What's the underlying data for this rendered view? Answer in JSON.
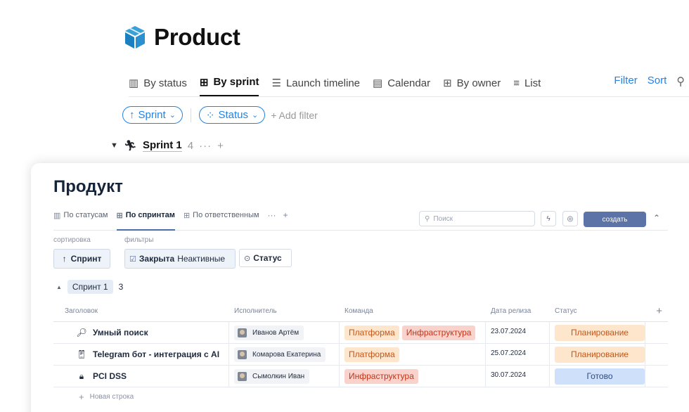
{
  "page": {
    "title": "Product",
    "icon": "cube-icon",
    "tabs": [
      {
        "label": "By status",
        "icon": "columns-icon"
      },
      {
        "label": "By sprint",
        "icon": "table-icon",
        "active": true
      },
      {
        "label": "Launch timeline",
        "icon": "timeline-icon"
      },
      {
        "label": "Calendar",
        "icon": "calendar-icon"
      },
      {
        "label": "By owner",
        "icon": "grid-icon"
      },
      {
        "label": "List",
        "icon": "list-icon"
      }
    ],
    "actions": {
      "filter": "Filter",
      "sort": "Sort"
    },
    "filters": {
      "sprint": "Sprint",
      "status": "Status",
      "add_filter": "Add filter"
    },
    "group": {
      "name": "Sprint 1",
      "count": "4"
    }
  },
  "card": {
    "title": "Продукт",
    "tabs": [
      {
        "label": "По статусам",
        "icon": "columns-icon"
      },
      {
        "label": "По спринтам",
        "icon": "table-icon",
        "active": true
      },
      {
        "label": "По ответственным",
        "icon": "table-icon"
      }
    ],
    "more": "···",
    "plus": "+",
    "search_placeholder": "Поиск",
    "create_label": "создать",
    "sort_caption": "сортировка",
    "filter_caption": "фильтры",
    "sort_value": "Спринт",
    "filter_closed": "Закрыта",
    "filter_inactive": "Неактивные",
    "status_filter": "Статус",
    "group": {
      "name": "Спринт 1",
      "count": "3"
    },
    "columns": [
      "Заголовок",
      "Исполнитель",
      "Команда",
      "Дата релиза",
      "Статус"
    ],
    "rows": [
      {
        "icon": "magnifier-icon",
        "title": "Умный поиск",
        "assignee": "Иванов Артём",
        "teams": [
          {
            "name": "Платформа",
            "color": "orange"
          },
          {
            "name": "Инфраструктура",
            "color": "red"
          }
        ],
        "date": "23.07.2024",
        "status": "Планирование",
        "status_kind": "plan"
      },
      {
        "icon": "phone-icon",
        "title": "Telegram бот - интеграция с AI",
        "assignee": "Комарова Екатерина",
        "teams": [
          {
            "name": "Платформа",
            "color": "orange"
          }
        ],
        "date": "25.07.2024",
        "status": "Планирование",
        "status_kind": "plan"
      },
      {
        "icon": "lock-icon",
        "title": "PCI DSS",
        "assignee": "Сымолкин Иван",
        "teams": [
          {
            "name": "Инфраструктура",
            "color": "red"
          }
        ],
        "date": "30.07.2024",
        "status": "Готово",
        "status_kind": "done"
      }
    ],
    "new_row": "Новая строка"
  },
  "colors": {
    "accent": "#2383e2",
    "create_button": "#5b73a6",
    "plan_bg": "#fde6cc",
    "done_bg": "#cfe0fa",
    "red_tag_bg": "#f9d2cc"
  }
}
